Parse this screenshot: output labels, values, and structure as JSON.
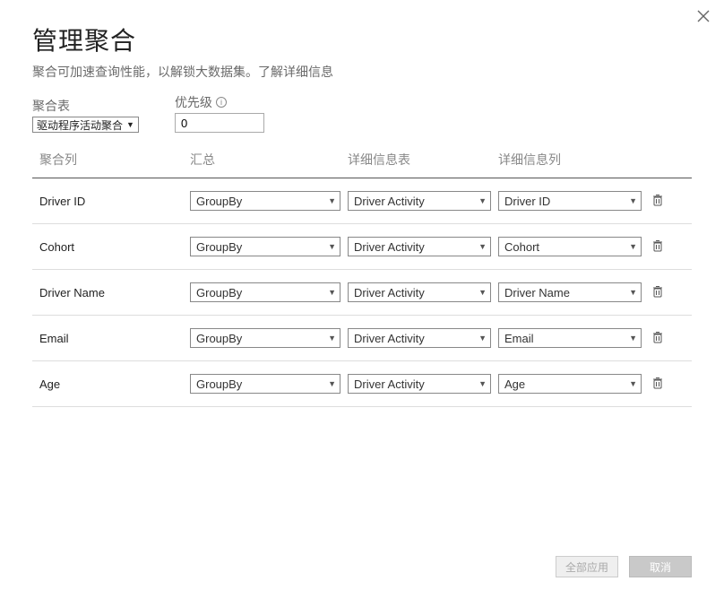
{
  "dialog": {
    "title": "管理聚合",
    "subtitle": "聚合可加速查询性能，以解锁大数据集。了解详细信息",
    "agg_table_label": "聚合表",
    "agg_table_value": "驱动程序活动聚合",
    "priority_label": "优先级",
    "priority_value": "0"
  },
  "headers": {
    "agg_col": "聚合列",
    "summary": "汇总",
    "detail_table": "详细信息表",
    "detail_col": "详细信息列"
  },
  "rows": [
    {
      "agg_col": "Driver ID",
      "summary": "GroupBy",
      "detail_table": "Driver Activity",
      "detail_col": "Driver ID"
    },
    {
      "agg_col": "Cohort",
      "summary": "GroupBy",
      "detail_table": "Driver Activity",
      "detail_col": "Cohort"
    },
    {
      "agg_col": "Driver Name",
      "summary": "GroupBy",
      "detail_table": "Driver Activity",
      "detail_col": "Driver Name"
    },
    {
      "agg_col": "Email",
      "summary": "GroupBy",
      "detail_table": "Driver Activity",
      "detail_col": "Email"
    },
    {
      "agg_col": "Age",
      "summary": "GroupBy",
      "detail_table": "Driver Activity",
      "detail_col": "Age"
    }
  ],
  "footer": {
    "apply_all": "全部应用",
    "cancel": "取消"
  }
}
